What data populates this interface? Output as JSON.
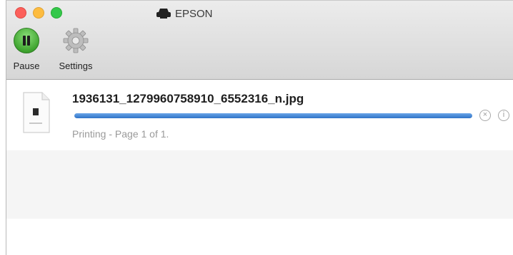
{
  "window": {
    "title": "EPSON",
    "title_icon": "printer-icon"
  },
  "toolbar": {
    "pause_label": "Pause",
    "settings_label": "Settings"
  },
  "job": {
    "file_name": "1936131_1279960758910_6552316_n.jpg",
    "status": "Printing - Page 1 of 1.",
    "progress": 1.0,
    "accent_color": "#2f73c8"
  }
}
